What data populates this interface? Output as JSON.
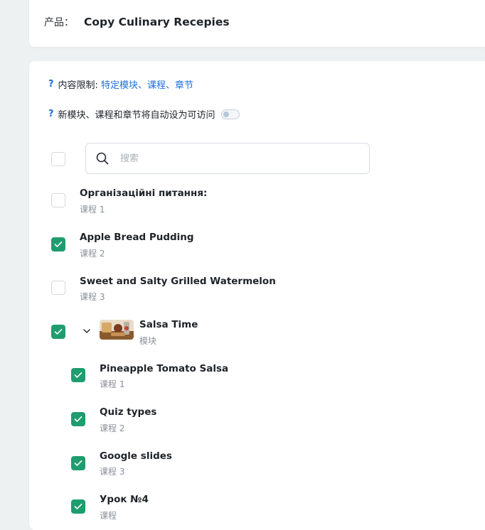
{
  "product": {
    "label": "产品：",
    "name": "Copy Culinary Recepies"
  },
  "restriction": {
    "icon": "question-mark-icon",
    "q": "?",
    "label": "内容限制:",
    "value": "特定模块、课程、章节"
  },
  "auto_access": {
    "q": "?",
    "label": "新模块、课程和章节将自动设为可访问",
    "enabled": false
  },
  "search": {
    "placeholder": "搜索",
    "value": ""
  },
  "items": [
    {
      "title": "Організаційні питання:",
      "sub": "课程 1",
      "checked": false
    },
    {
      "title": "Apple Bread Pudding",
      "sub": "课程 2",
      "checked": true
    },
    {
      "title": "Sweet and Salty Grilled Watermelon",
      "sub": "课程 3",
      "checked": false
    },
    {
      "title": "Salsa Time",
      "sub": "模块",
      "checked": true
    },
    {
      "title": "Pineapple Tomato Salsa",
      "sub": "课程 1",
      "checked": true
    },
    {
      "title": "Quiz types",
      "sub": "课程 2",
      "checked": true
    },
    {
      "title": "Google slides",
      "sub": "课程 3",
      "checked": true
    },
    {
      "title": "Урок №4",
      "sub": "课程",
      "checked": true
    }
  ],
  "colors": {
    "accent": "#1f9d6f",
    "link": "#1e6fd9"
  }
}
